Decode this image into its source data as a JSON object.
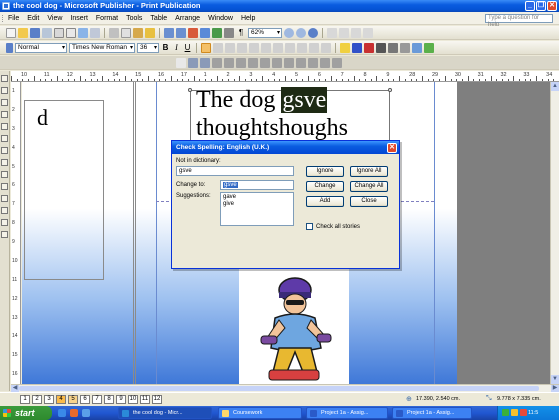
{
  "window": {
    "title": "the cool dog - Microsoft Publisher - Print Publication"
  },
  "menu": {
    "items": [
      "File",
      "Edit",
      "View",
      "Insert",
      "Format",
      "Tools",
      "Table",
      "Arrange",
      "Window",
      "Help"
    ],
    "help_placeholder": "Type a question for help"
  },
  "toolbar": {
    "zoom": "62%",
    "style": "Normal",
    "font": "Times New Roman",
    "size": "36",
    "bold": "B",
    "italic": "I",
    "underline": "U"
  },
  "ruler": {
    "h_numbers": [
      "10",
      "11",
      "12",
      "13",
      "14",
      "15",
      "16",
      "17",
      "1",
      "2",
      "3",
      "4",
      "5",
      "6",
      "7",
      "8",
      "9",
      "28",
      "29",
      "30",
      "31",
      "32",
      "33",
      "34"
    ],
    "v_numbers": [
      "1",
      "2",
      "3",
      "4",
      "5",
      "6",
      "7",
      "8",
      "9",
      "10",
      "11",
      "12",
      "13",
      "14",
      "15",
      "16"
    ]
  },
  "document": {
    "left_letter": "d",
    "heading_word": "The dog",
    "misspelled": "gsve",
    "second_line": "thoughtshoughs"
  },
  "dialog": {
    "title": "Check Spelling: English (U.K.)",
    "not_in_dictionary_label": "Not in dictionary:",
    "not_in_dictionary_value": "gsve",
    "change_to_label": "Change to:",
    "change_to_value": "gsve",
    "suggestions_label": "Suggestions:",
    "suggestions": [
      "gave",
      "give"
    ],
    "buttons": {
      "ignore": "Ignore",
      "ignore_all": "Ignore All",
      "change": "Change",
      "change_all": "Change All",
      "add": "Add",
      "close": "Close"
    },
    "check_all_stories": "Check all stories"
  },
  "status": {
    "pages": [
      "1",
      "2",
      "3",
      "4",
      "5",
      "6",
      "7",
      "8",
      "9",
      "10",
      "11",
      "12"
    ],
    "active_page": "4",
    "position": "17.390, 2.540 cm.",
    "size": "9.778 x 7.335 cm."
  },
  "taskbar": {
    "start": "start",
    "tasks": [
      "the cool dog - Micr...",
      "Coursework",
      "Project 1a - Assig...",
      "Project 1a - Assig..."
    ],
    "clock": "11:5"
  }
}
